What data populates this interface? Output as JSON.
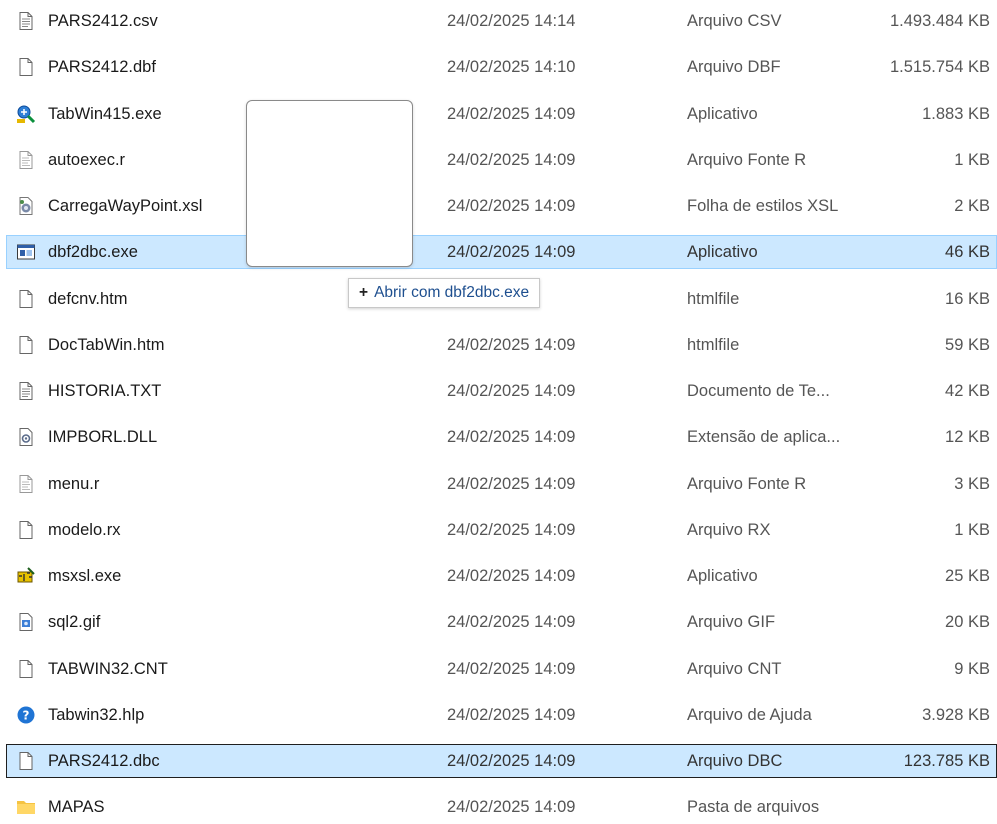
{
  "rows": [
    {
      "name": "PARS2412.csv",
      "date": "24/02/2025 14:14",
      "type": "Arquivo CSV",
      "size": "1.493.484 KB",
      "icon": "text-document-icon"
    },
    {
      "name": "PARS2412.dbf",
      "date": "24/02/2025 14:10",
      "type": "Arquivo DBF",
      "size": "1.515.754 KB",
      "icon": "blank-file-icon"
    },
    {
      "name": "TabWin415.exe",
      "date": "24/02/2025 14:09",
      "type": "Aplicativo",
      "size": "1.883 KB",
      "icon": "tabwin-app-icon"
    },
    {
      "name": "autoexec.r",
      "date": "24/02/2025 14:09",
      "type": "Arquivo Fonte R",
      "size": "1 KB",
      "icon": "source-file-icon"
    },
    {
      "name": "CarregaWayPoint.xsl",
      "date": "24/02/2025 14:09",
      "type": "Folha de estilos XSL",
      "size": "2 KB",
      "icon": "xsl-file-icon"
    },
    {
      "name": "dbf2dbc.exe",
      "date": "24/02/2025 14:09",
      "type": "Aplicativo",
      "size": "46 KB",
      "icon": "window-app-icon",
      "state": "selected"
    },
    {
      "name": "defcnv.htm",
      "date": "",
      "type": "htmlfile",
      "size": "16 KB",
      "icon": "blank-file-icon"
    },
    {
      "name": "DocTabWin.htm",
      "date": "24/02/2025 14:09",
      "type": "htmlfile",
      "size": "59 KB",
      "icon": "blank-file-icon"
    },
    {
      "name": "HISTORIA.TXT",
      "date": "24/02/2025 14:09",
      "type": "Documento de Te...",
      "size": "42 KB",
      "icon": "text-document-icon"
    },
    {
      "name": "IMPBORL.DLL",
      "date": "24/02/2025 14:09",
      "type": "Extensão de aplica...",
      "size": "12 KB",
      "icon": "dll-file-icon"
    },
    {
      "name": "menu.r",
      "date": "24/02/2025 14:09",
      "type": "Arquivo Fonte R",
      "size": "3 KB",
      "icon": "source-file-icon"
    },
    {
      "name": "modelo.rx",
      "date": "24/02/2025 14:09",
      "type": "Arquivo RX",
      "size": "1 KB",
      "icon": "blank-file-icon"
    },
    {
      "name": "msxsl.exe",
      "date": "24/02/2025 14:09",
      "type": "Aplicativo",
      "size": "25 KB",
      "icon": "msxsl-app-icon"
    },
    {
      "name": "sql2.gif",
      "date": "24/02/2025 14:09",
      "type": "Arquivo GIF",
      "size": "20 KB",
      "icon": "image-file-icon"
    },
    {
      "name": "TABWIN32.CNT",
      "date": "24/02/2025 14:09",
      "type": "Arquivo CNT",
      "size": "9 KB",
      "icon": "blank-file-icon"
    },
    {
      "name": "Tabwin32.hlp",
      "date": "24/02/2025 14:09",
      "type": "Arquivo de Ajuda",
      "size": "3.928 KB",
      "icon": "help-question-icon"
    },
    {
      "name": "PARS2412.dbc",
      "date": "24/02/2025 14:09",
      "type": "Arquivo DBC",
      "size": "123.785 KB",
      "icon": "blank-file-icon",
      "state": "focused"
    },
    {
      "name": "MAPAS",
      "date": "24/02/2025 14:09",
      "type": "Pasta de arquivos",
      "size": "",
      "icon": "folder-icon"
    }
  ],
  "drag": {
    "tooltip_plus": "+",
    "tooltip_text": "Abrir com dbf2dbc.exe"
  },
  "colors": {
    "selection_bg": "#cce8ff",
    "selection_border": "#99d1ff",
    "tooltip_text": "#1e4f8f",
    "folder": "#f5c342"
  }
}
